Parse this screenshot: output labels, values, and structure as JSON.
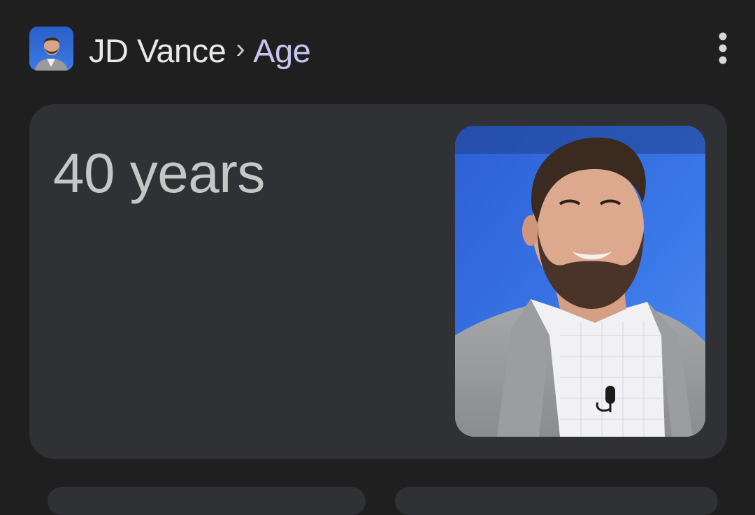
{
  "header": {
    "entity_name": "JD Vance",
    "separator": "›",
    "attribute": "Age",
    "thumbnail_icon": "person-thumbnail",
    "more_icon": "more-vertical-icon"
  },
  "answer": {
    "value": "40 years",
    "image_icon": "person-portrait"
  },
  "colors": {
    "background": "#1f1f20",
    "card": "#303134",
    "attribute_accent": "#c8c4f0",
    "answer_text": "#c4c7c5"
  }
}
